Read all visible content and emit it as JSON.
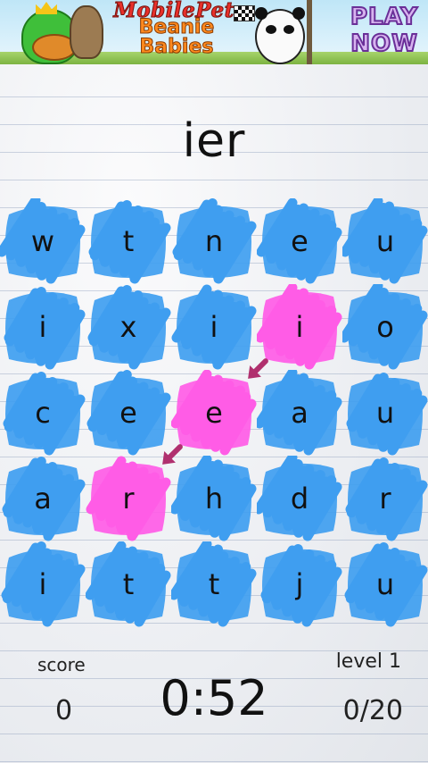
{
  "ad": {
    "brand": "MobilePet",
    "product_line1": "Beanie",
    "product_line2": "Babies",
    "cta": "PLAY NOW"
  },
  "game": {
    "current_word": "ier",
    "grid": [
      [
        "w",
        "t",
        "n",
        "e",
        "u"
      ],
      [
        "i",
        "x",
        "i",
        "i",
        "o"
      ],
      [
        "c",
        "e",
        "e",
        "a",
        "u"
      ],
      [
        "a",
        "r",
        "h",
        "d",
        "r"
      ],
      [
        "i",
        "t",
        "t",
        "j",
        "u"
      ]
    ],
    "selected_path": [
      [
        1,
        3
      ],
      [
        2,
        2
      ],
      [
        3,
        1
      ]
    ],
    "colors": {
      "tile": "#3f9ef0",
      "selected": "#ff5ce6",
      "arrow": "#b0306e"
    }
  },
  "footer": {
    "score_label": "score",
    "score_value": "0",
    "timer": "0:52",
    "level_label": "level 1",
    "progress": "0/20"
  }
}
